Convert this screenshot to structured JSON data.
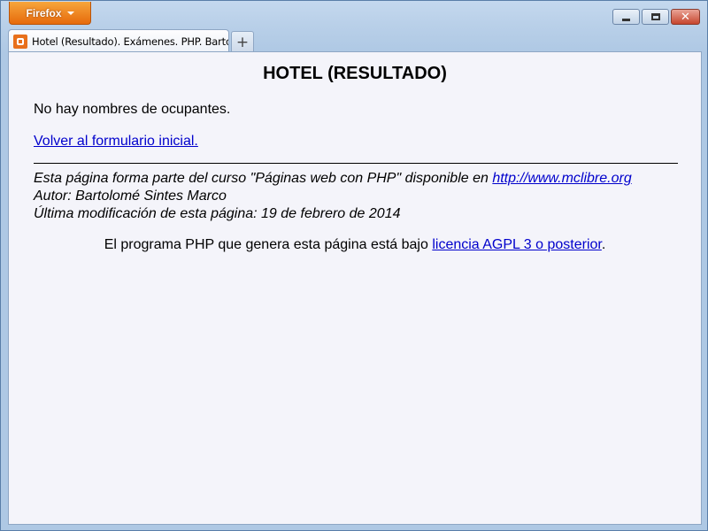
{
  "browser": {
    "menu_button_label": "Firefox",
    "tab_title": "Hotel (Resultado). Exámenes. PHP. Barto...",
    "new_tab_label": "+"
  },
  "page": {
    "title": "HOTEL (RESULTADO)",
    "message": "No hay nombres de ocupantes.",
    "back_link": "Volver al formulario inicial.",
    "footer": {
      "course_text": "Esta página forma parte del curso \"Páginas web con PHP\" disponible en ",
      "course_link": "http://www.mclibre.org",
      "author": "Autor: Bartolomé Sintes Marco",
      "modified": "Última modificación de esta página: 19 de febrero de 2014"
    },
    "license": {
      "text": "El programa PHP que genera esta página está bajo ",
      "link": "licencia AGPL 3 o posterior",
      "suffix": "."
    }
  },
  "colors": {
    "firefox_button": "#e66a0c",
    "link": "#0000cc",
    "page_background": "#f4f4fa"
  }
}
